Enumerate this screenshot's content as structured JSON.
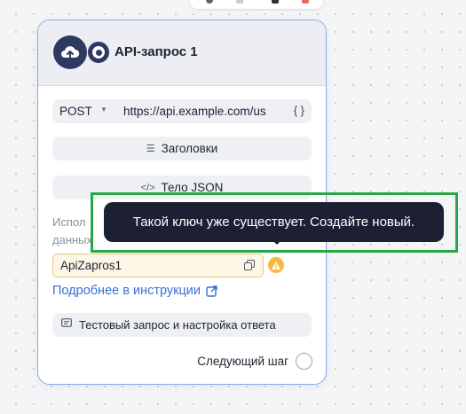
{
  "node": {
    "title": "API-запрос 1",
    "method": "POST",
    "url": "https://api.example.com/us",
    "braces": "{ }",
    "headers_label": "Заголовки",
    "body_label": "Тело JSON",
    "hint_line1": "Испол",
    "hint_line2": "данных",
    "key_value": "ApiZapros1",
    "docs_link": "Подробнее в инструкции",
    "test_label": "Тестовый запрос и настройка ответа",
    "next_step": "Следующий шаг"
  },
  "tooltip": {
    "text": "Такой ключ уже существует. Создайте новый."
  },
  "colors": {
    "accent_blue": "#3b6fd6",
    "header_icon": "#2e3962",
    "warning": "#f5b945",
    "highlight_border": "#28a745",
    "tooltip_bg": "#1d2033"
  },
  "icons": [
    "upload-cloud-icon",
    "target-icon",
    "caret-down-icon",
    "braces-icon",
    "list-icon",
    "code-icon",
    "copy-icon",
    "warning-icon",
    "external-link-icon",
    "message-icon"
  ]
}
